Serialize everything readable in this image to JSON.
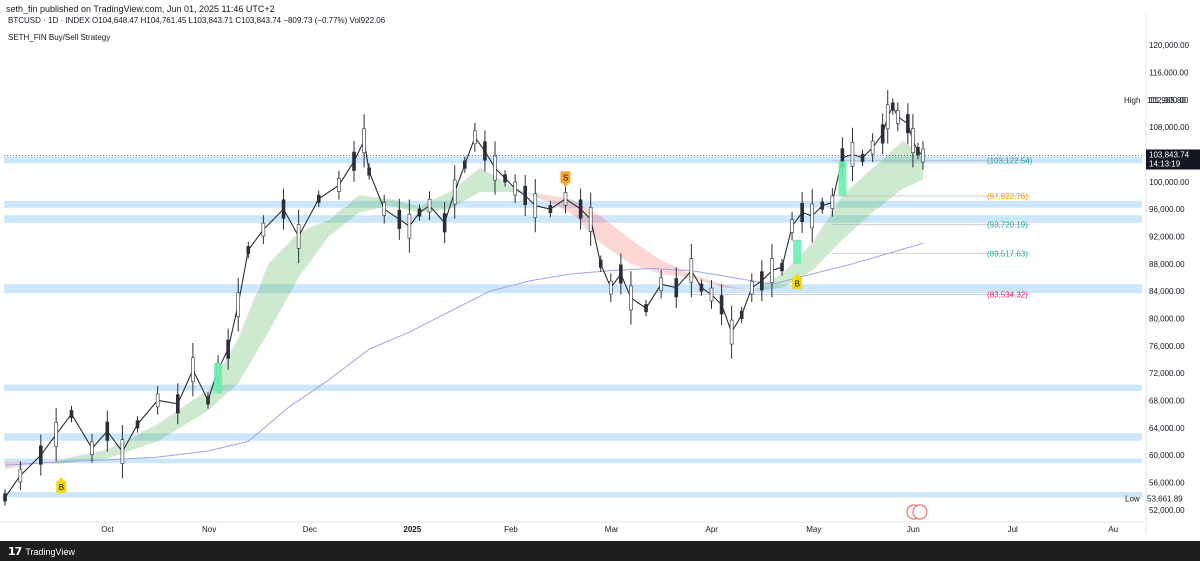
{
  "header": {
    "published": "seth_fin published on TradingView.com, Jun 01, 2025 11:46 UTC+2",
    "ohlc": "BTCUSD · 1D · INDEX  O104,648.47  H104,761.45  L103,843.71  C103,843.74  −809.73 (−0.77%)  Vol922.06",
    "indicator": "SETH_FIN Buy/Sell Strategy"
  },
  "footer": {
    "brand": "TradingView",
    "logo_icon": "tradingview-logo-icon"
  },
  "chart_data": {
    "type": "line",
    "ylim": [
      50500,
      122500
    ],
    "y_ticks": [
      "52,000.00",
      "56,000.00",
      "60,000.00",
      "64,000.00",
      "68,000.00",
      "72,000.00",
      "76,000.00",
      "80,000.00",
      "84,000.00",
      "88,000.00",
      "92,000.00",
      "96,000.00",
      "100,000.00",
      "104,000.00",
      "108,000.00",
      "112,000.00",
      "116,000.00",
      "120,000.00"
    ],
    "x_ticks": [
      {
        "label": "Oct",
        "month_index": 1
      },
      {
        "label": "Nov",
        "month_index": 2
      },
      {
        "label": "Dec",
        "month_index": 3
      },
      {
        "label": "2025",
        "month_index": 4
      },
      {
        "label": "Feb",
        "month_index": 5
      },
      {
        "label": "Mar",
        "month_index": 6
      },
      {
        "label": "Apr",
        "month_index": 7
      },
      {
        "label": "May",
        "month_index": 8
      },
      {
        "label": "Jun",
        "month_index": 9
      },
      {
        "label": "Jul",
        "month_index": 10
      },
      {
        "label": "Au",
        "month_index": 11
      }
    ],
    "x_range_months": [
      0,
      11.1
    ],
    "price_line": {
      "name": "BTCUSD",
      "color": "#2a2e39",
      "points": [
        [
          0.0,
          53800
        ],
        [
          0.15,
          57000
        ],
        [
          0.35,
          60000
        ],
        [
          0.5,
          63000
        ],
        [
          0.65,
          66000
        ],
        [
          0.85,
          61000
        ],
        [
          1.0,
          63500
        ],
        [
          1.15,
          60500
        ],
        [
          1.3,
          64500
        ],
        [
          1.5,
          68000
        ],
        [
          1.7,
          67500
        ],
        [
          1.85,
          72500
        ],
        [
          2.0,
          68000
        ],
        [
          2.1,
          72500
        ],
        [
          2.2,
          75500
        ],
        [
          2.3,
          82000
        ],
        [
          2.4,
          90000
        ],
        [
          2.55,
          93000
        ],
        [
          2.75,
          96000
        ],
        [
          2.9,
          92000
        ],
        [
          3.1,
          97500
        ],
        [
          3.3,
          99500
        ],
        [
          3.45,
          103000
        ],
        [
          3.55,
          106000
        ],
        [
          3.6,
          101500
        ],
        [
          3.75,
          96000
        ],
        [
          3.9,
          94500
        ],
        [
          4.0,
          93500
        ],
        [
          4.1,
          95500
        ],
        [
          4.2,
          96500
        ],
        [
          4.35,
          94000
        ],
        [
          4.45,
          98500
        ],
        [
          4.55,
          102500
        ],
        [
          4.65,
          106500
        ],
        [
          4.75,
          104500
        ],
        [
          4.85,
          102000
        ],
        [
          4.95,
          100500
        ],
        [
          5.05,
          99000
        ],
        [
          5.15,
          98000
        ],
        [
          5.25,
          96500
        ],
        [
          5.4,
          96000
        ],
        [
          5.55,
          97500
        ],
        [
          5.7,
          96000
        ],
        [
          5.8,
          94500
        ],
        [
          5.9,
          88000
        ],
        [
          6.0,
          84500
        ],
        [
          6.1,
          86500
        ],
        [
          6.2,
          83000
        ],
        [
          6.35,
          81500
        ],
        [
          6.5,
          85000
        ],
        [
          6.65,
          84500
        ],
        [
          6.8,
          87000
        ],
        [
          6.9,
          84500
        ],
        [
          7.0,
          83500
        ],
        [
          7.1,
          82000
        ],
        [
          7.2,
          78000
        ],
        [
          7.3,
          80500
        ],
        [
          7.4,
          84500
        ],
        [
          7.5,
          85500
        ],
        [
          7.6,
          87000
        ],
        [
          7.7,
          87500
        ],
        [
          7.8,
          93500
        ],
        [
          7.9,
          95500
        ],
        [
          8.0,
          95000
        ],
        [
          8.1,
          96500
        ],
        [
          8.2,
          97000
        ],
        [
          8.3,
          103500
        ],
        [
          8.4,
          104000
        ],
        [
          8.5,
          103500
        ],
        [
          8.6,
          105000
        ],
        [
          8.7,
          107000
        ],
        [
          8.75,
          109500
        ],
        [
          8.8,
          111000
        ],
        [
          8.85,
          109500
        ],
        [
          8.95,
          108500
        ],
        [
          9.0,
          106000
        ],
        [
          9.05,
          104500
        ],
        [
          9.1,
          103844
        ]
      ]
    },
    "ema_band": {
      "fast": [
        [
          0.0,
          58000
        ],
        [
          0.5,
          59200
        ],
        [
          1.0,
          60800
        ],
        [
          1.5,
          64500
        ],
        [
          2.0,
          69500
        ],
        [
          2.3,
          77000
        ],
        [
          2.6,
          88000
        ],
        [
          2.9,
          92500
        ],
        [
          3.2,
          94500
        ],
        [
          3.5,
          98000
        ],
        [
          3.8,
          97500
        ],
        [
          4.1,
          96500
        ],
        [
          4.4,
          98500
        ],
        [
          4.7,
          102000
        ],
        [
          5.0,
          99500
        ],
        [
          5.3,
          97500
        ],
        [
          5.6,
          95500
        ],
        [
          5.9,
          91000
        ],
        [
          6.2,
          88000
        ],
        [
          6.5,
          86500
        ],
        [
          6.8,
          86000
        ],
        [
          7.1,
          84500
        ],
        [
          7.4,
          84000
        ],
        [
          7.7,
          86500
        ],
        [
          8.0,
          91000
        ],
        [
          8.3,
          98000
        ],
        [
          8.6,
          102000
        ],
        [
          8.9,
          106000
        ],
        [
          9.1,
          104000
        ]
      ],
      "slow": [
        [
          0.0,
          59000
        ],
        [
          0.5,
          58700
        ],
        [
          1.0,
          59500
        ],
        [
          1.5,
          62000
        ],
        [
          2.0,
          66500
        ],
        [
          2.3,
          70500
        ],
        [
          2.6,
          78000
        ],
        [
          2.9,
          86000
        ],
        [
          3.2,
          92000
        ],
        [
          3.5,
          95500
        ],
        [
          3.8,
          96500
        ],
        [
          4.1,
          95500
        ],
        [
          4.4,
          96000
        ],
        [
          4.7,
          98500
        ],
        [
          5.0,
          98500
        ],
        [
          5.3,
          98200
        ],
        [
          5.6,
          97500
        ],
        [
          5.9,
          95000
        ],
        [
          6.2,
          91500
        ],
        [
          6.5,
          88500
        ],
        [
          6.8,
          86500
        ],
        [
          7.1,
          85000
        ],
        [
          7.4,
          84000
        ],
        [
          7.7,
          84500
        ],
        [
          8.0,
          87000
        ],
        [
          8.3,
          91500
        ],
        [
          8.6,
          95500
        ],
        [
          8.9,
          99000
        ],
        [
          9.1,
          100300
        ]
      ],
      "bull_color": "#4caf50",
      "bear_color": "#f44336"
    },
    "sma_line": {
      "color": "#9fa3e6",
      "points": [
        [
          0.0,
          58500
        ],
        [
          0.5,
          59000
        ],
        [
          1.0,
          59300
        ],
        [
          1.5,
          59700
        ],
        [
          2.0,
          60600
        ],
        [
          2.4,
          62000
        ],
        [
          2.8,
          67000
        ],
        [
          3.2,
          71000
        ],
        [
          3.6,
          75500
        ],
        [
          4.0,
          78000
        ],
        [
          4.4,
          81000
        ],
        [
          4.8,
          84000
        ],
        [
          5.2,
          85500
        ],
        [
          5.6,
          86500
        ],
        [
          6.0,
          87000
        ],
        [
          6.4,
          87300
        ],
        [
          6.8,
          87000
        ],
        [
          7.2,
          86000
        ],
        [
          7.6,
          85000
        ],
        [
          8.0,
          86500
        ],
        [
          8.4,
          88000
        ],
        [
          8.8,
          89700
        ],
        [
          9.1,
          91000
        ]
      ]
    },
    "horizontal_zones": [
      {
        "y1": 53800,
        "y2": 54600
      },
      {
        "y1": 58800,
        "y2": 59500
      },
      {
        "y1": 62100,
        "y2": 63200
      },
      {
        "y1": 69400,
        "y2": 70300
      },
      {
        "y1": 83700,
        "y2": 85000
      },
      {
        "y1": 94000,
        "y2": 95100
      },
      {
        "y1": 96200,
        "y2": 97200
      },
      {
        "y1": 102700,
        "y2": 103700
      }
    ],
    "levels": [
      {
        "value": 103122.54,
        "label": "(103,122.54)",
        "color": "#26a69a",
        "x_from": 8.2
      },
      {
        "value": 97922.76,
        "label": "(97,922.76)",
        "color": "#ff9800",
        "x_from": 8.2
      },
      {
        "value": 93720.19,
        "label": "(93,720.19)",
        "color": "#26a69a",
        "x_from": 8.2
      },
      {
        "value": 89517.63,
        "label": "(89,517.63)",
        "color": "#26a69a",
        "x_from": 8.2
      },
      {
        "value": 83534.32,
        "label": "(83,534.32)",
        "color": "#e91e63",
        "x_from": 6.8
      }
    ],
    "signals": [
      {
        "type": "B",
        "x": 0.55,
        "y": 55200,
        "color": "#f5d90a"
      },
      {
        "type": "S",
        "x": 5.55,
        "y": 100500,
        "color": "#f7a52d"
      },
      {
        "type": "B",
        "x": 7.85,
        "y": 85000,
        "color": "#f5d90a"
      }
    ],
    "signal_bars": [
      {
        "x": 2.1,
        "y1": 69000,
        "y2": 73500,
        "color": "#69f0ae"
      },
      {
        "x": 7.85,
        "y1": 88000,
        "y2": 91500,
        "color": "#69f0ae"
      },
      {
        "x": 8.3,
        "y1": 98000,
        "y2": 103000,
        "color": "#69f0ae"
      }
    ],
    "high": {
      "label": "High",
      "value": "111,965.80",
      "y": 111965.8
    },
    "low": {
      "label": "Low",
      "value": "53,661.89",
      "y": 53661.89
    },
    "last_price": {
      "value": "103,843.74",
      "timer": "14:13:19",
      "y": 103843.74
    },
    "x_axis_badge": {
      "month_index": 9.05,
      "icon": "calendar-flag-icon"
    }
  }
}
